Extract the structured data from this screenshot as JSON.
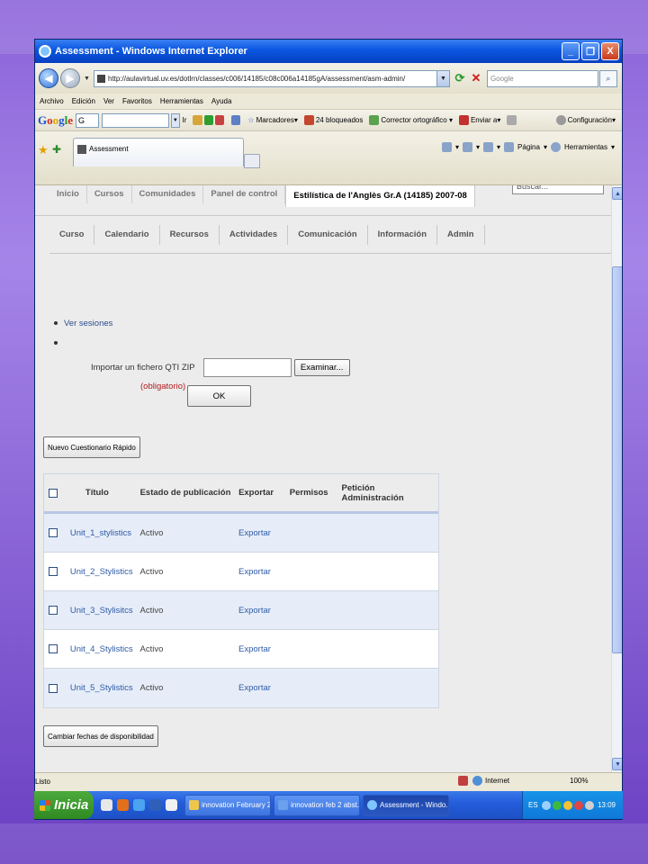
{
  "window": {
    "title": "Assessment - Windows Internet Explorer",
    "controls": {
      "minimize": "_",
      "maximize": "❐",
      "close": "X"
    }
  },
  "address_bar": {
    "url": "http://aulavirtual.uv.es/dotlrn/classes/c006/14185/c08c006a14185gA/assessment/asm-admin/",
    "search_placeholder": "Google"
  },
  "menu": [
    "Archivo",
    "Edición",
    "Ver",
    "Favoritos",
    "Herramientas",
    "Ayuda"
  ],
  "google_toolbar": {
    "logo": "Google",
    "mini_box": "G",
    "items": [
      {
        "label": "Ir",
        "icon": "go-icon"
      },
      {
        "label": "Marcadores",
        "icon": "bookmarks-star-icon"
      },
      {
        "label": "24 bloqueados",
        "icon": "popup-blocker-icon"
      },
      {
        "label": "Corrector ortográfico",
        "icon": "spellcheck-icon"
      },
      {
        "label": "Enviar a",
        "icon": "send-to-icon"
      },
      {
        "label": "Configuración",
        "icon": "settings-icon"
      }
    ]
  },
  "tab": {
    "label": "Assessment"
  },
  "command_bar": {
    "page": "Página",
    "tools": "Herramientas"
  },
  "site": {
    "nav": [
      "Inicio",
      "Cursos",
      "Comunidades",
      "Panel de control"
    ],
    "active_course": "Estilística de l'Anglès Gr.A (14185) 2007-08",
    "search_placeholder": "Buscar...",
    "subnav": [
      "Curso",
      "Calendario",
      "Recursos",
      "Actividades",
      "Comunicación",
      "Información",
      "Admin"
    ]
  },
  "content": {
    "bullet_link": "Ver sesiones",
    "import_label": "Importar un fichero QTI ZIP",
    "browse_button": "Examinar...",
    "required_label": "(obligatorio)",
    "ok_button": "OK",
    "quick_quiz_button": "Nuevo Cuestionario Rápido",
    "dates_button": "Cambiar fechas de disponibilidad"
  },
  "table": {
    "headers": [
      "Título",
      "Estado de publicación",
      "Exportar",
      "Permisos",
      "Petición Administración"
    ],
    "rows": [
      {
        "title": "Unit_1_stylistics",
        "status": "Activo",
        "export": "Exportar"
      },
      {
        "title": "Unit_2_Stylistics",
        "status": "Activo",
        "export": "Exportar"
      },
      {
        "title": "Unit_3_Stylisitcs",
        "status": "Activo",
        "export": "Exportar"
      },
      {
        "title": "Unit_4_Stylistics",
        "status": "Activo",
        "export": "Exportar"
      },
      {
        "title": "Unit_5_Stylistics",
        "status": "Activo",
        "export": "Exportar"
      }
    ]
  },
  "status_bar": {
    "text": "Listo",
    "zone": "Internet",
    "zoom": "100%"
  },
  "taskbar": {
    "start": "Inicia",
    "buttons": [
      "innovation February 2",
      "innovation feb 2 abst...",
      "Assessment - Windo..."
    ],
    "language": "ES",
    "clock": "13:09"
  },
  "colors": {
    "link": "#2e5aa6",
    "required": "#b11b1b",
    "row_alt": "#e6edf8",
    "titlebar": "#0a56e0"
  }
}
